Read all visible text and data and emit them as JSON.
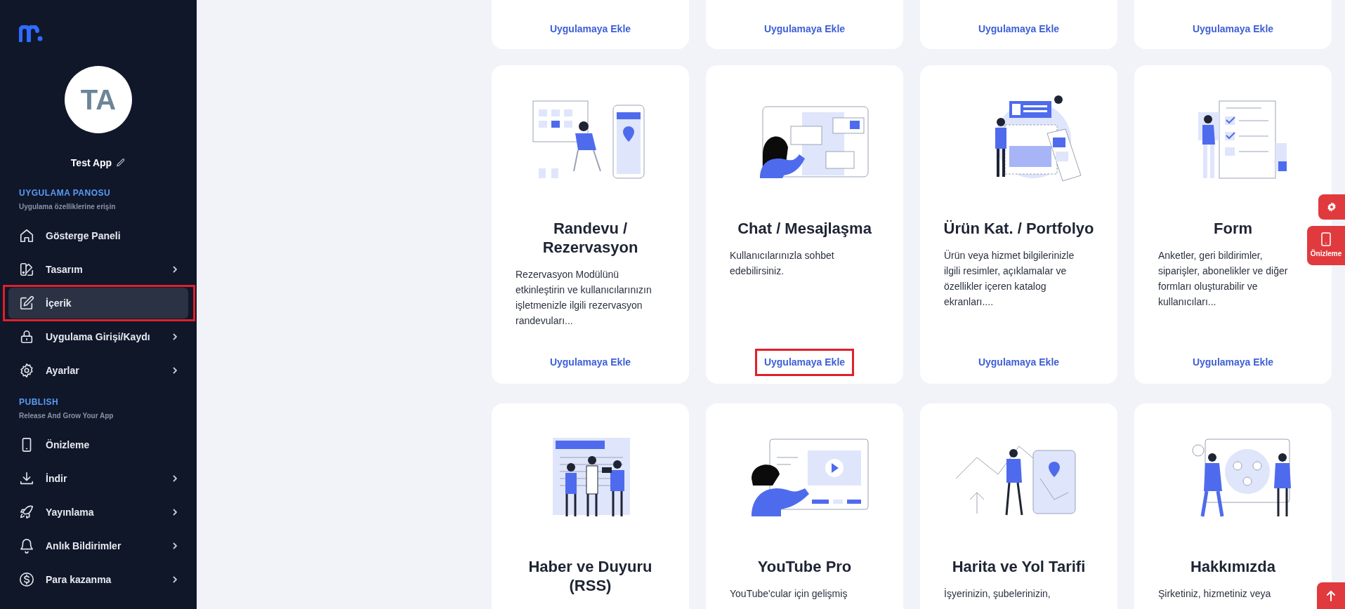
{
  "sidebar": {
    "avatar_initials": "TA",
    "app_name": "Test App",
    "sections": [
      {
        "title": "UYGULAMA PANOSU",
        "subtitle": "Uygulama özelliklerine erişin",
        "items": [
          {
            "label": "Gösterge Paneli",
            "expandable": false,
            "selected": false,
            "annotated": false
          },
          {
            "label": "Tasarım",
            "expandable": true,
            "selected": false,
            "annotated": false
          },
          {
            "label": "İçerik",
            "expandable": false,
            "selected": true,
            "annotated": true
          },
          {
            "label": "Uygulama Girişi/Kaydı",
            "expandable": true,
            "selected": false,
            "annotated": false
          },
          {
            "label": "Ayarlar",
            "expandable": true,
            "selected": false,
            "annotated": false
          }
        ]
      },
      {
        "title": "PUBLISH",
        "subtitle": "Release And Grow Your App",
        "items": [
          {
            "label": "Önizleme",
            "expandable": false,
            "selected": false,
            "annotated": false
          },
          {
            "label": "İndir",
            "expandable": true,
            "selected": false,
            "annotated": false
          },
          {
            "label": "Yayınlama",
            "expandable": true,
            "selected": false,
            "annotated": false
          },
          {
            "label": "Anlık Bildirimler",
            "expandable": true,
            "selected": false,
            "annotated": false
          },
          {
            "label": "Para kazanma",
            "expandable": true,
            "selected": false,
            "annotated": false
          }
        ]
      }
    ]
  },
  "partial_cards": [
    {
      "action": "Uygulamaya Ekle"
    },
    {
      "action": "Uygulamaya Ekle"
    },
    {
      "action": "Uygulamaya Ekle"
    },
    {
      "action": "Uygulamaya Ekle"
    }
  ],
  "cards": [
    {
      "title": "Randevu / Rezervasyon",
      "description": "Rezervasyon Modülünü etkinleştirin ve kullanıcılarınızın işletmenizle ilgili rezervasyon randevuları...",
      "action": "Uygulamaya Ekle",
      "annotated": false
    },
    {
      "title": "Chat / Mesajlaşma",
      "description": "Kullanıcılarınızla sohbet edebilirsiniz.",
      "action": "Uygulamaya Ekle",
      "annotated": true
    },
    {
      "title": "Ürün Kat. / Portfolyo",
      "description": "Ürün veya hizmet bilgilerinizle ilgili resimler, açıklamalar ve özellikler içeren katalog ekranları....",
      "action": "Uygulamaya Ekle",
      "annotated": false
    },
    {
      "title": "Form",
      "description": "Anketler, geri bildirimler, siparişler, abonelikler ve diğer formları oluşturabilir ve kullanıcıları...",
      "action": "Uygulamaya Ekle",
      "annotated": false
    },
    {
      "title": "Haber ve Duyuru (RSS)"
    },
    {
      "title": "YouTube Pro",
      "description": "YouTube'cular için gelişmiş"
    },
    {
      "title": "Harita ve Yol Tarifi",
      "description": "İşyerinizin, şubelerinizin,"
    },
    {
      "title": "Hakkımızda",
      "description": "Şirketiniz, hizmetiniz veya"
    }
  ],
  "floating_buttons": [
    {
      "kind": "settings"
    },
    {
      "kind": "preview",
      "label": "Önizleme"
    },
    {
      "kind": "scroll_top"
    }
  ]
}
